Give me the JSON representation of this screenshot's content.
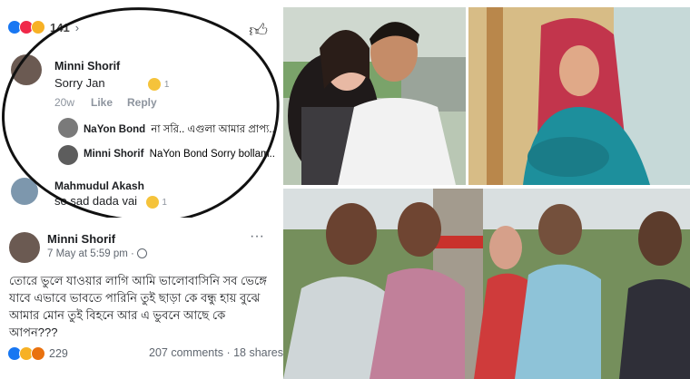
{
  "comments_panel": {
    "reaction_count": "141",
    "comments": [
      {
        "name": "Minni Shorif",
        "text": "Sorry Jan",
        "reaction_count": "1",
        "time": "20w",
        "like": "Like",
        "reply": "Reply"
      },
      {
        "name": "NaYon Bond",
        "text": "না সরি.. এগুলা আমার প্রাপ্য..."
      },
      {
        "name": "Minni Shorif",
        "text": "NaYon Bond Sorry bollam..."
      },
      {
        "name": "Mahmudul Akash",
        "text": "so sad dada vai",
        "reaction_count": "1"
      }
    ]
  },
  "post_panel": {
    "author": "Minni Shorif",
    "time": "7 May at 5:59 pm ·",
    "text": "তোরে ভুলে যাওয়ার লাগি আমি ভালোবাসিনি সব ভেঙ্গে যাবে এভাবে ভাবতে পারিনি তুই ছাড়া কে বন্ধু হায় বুঝে আমার মোন তুই বিহনে আর এ ভুবনে আছে কে আপন???",
    "reaction_count": "229",
    "comments": "207 comments",
    "shares": "· 18 shares"
  },
  "colors": {
    "like_blue": "#1877f2",
    "love_red": "#f02849",
    "haha_yellow": "#f7b125",
    "text": "#1c1e21",
    "meta": "#8d949e"
  }
}
